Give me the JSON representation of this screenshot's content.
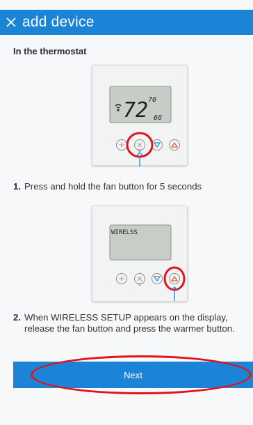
{
  "header": {
    "title": "add device",
    "close_icon": "close-icon"
  },
  "section_title": "In the thermostat",
  "thermostat_1": {
    "main_temp": "72",
    "setpoint_high": "70",
    "setpoint_low": "66"
  },
  "thermostat_2": {
    "display_text": "WIRELSS"
  },
  "steps": [
    {
      "number": "1.",
      "text": "Press and hold the fan button for 5 seconds"
    },
    {
      "number": "2.",
      "text": "When WIRELESS SETUP appears on the display, release the fan button and press the warmer button."
    }
  ],
  "next_button": {
    "label": "Next"
  },
  "colors": {
    "brand_blue": "#1b84d6",
    "highlight_red": "#e3121b",
    "cold_blue": "#2a8ad8",
    "warm_red": "#e0533a"
  }
}
